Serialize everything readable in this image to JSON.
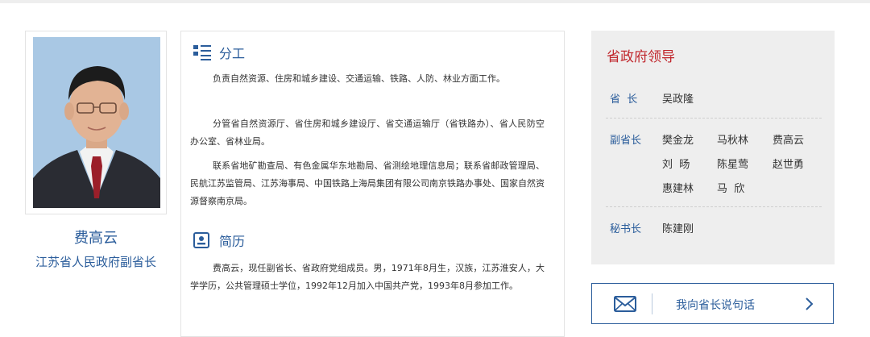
{
  "profile": {
    "name": "费高云",
    "title": "江苏省人民政府副省长"
  },
  "duties": {
    "heading": "分工",
    "paragraphs": [
      "负责自然资源、住房和城乡建设、交通运输、铁路、人防、林业方面工作。",
      "分管省自然资源厅、省住房和城乡建设厅、省交通运输厅（省铁路办）、省人民防空办公室、省林业局。",
      "联系省地矿勘查局、有色金属华东地勘局、省测绘地理信息局；联系省邮政管理局、民航江苏监管局、江苏海事局、中国铁路上海局集团有限公司南京铁路办事处、国家自然资源督察南京局。"
    ]
  },
  "resume": {
    "heading": "简历",
    "paragraph": "费高云，现任副省长、省政府党组成员。男，1971年8月生，汉族，江苏淮安人，大学学历，公共管理硕士学位，1992年12月加入中国共产党，1993年8月参加工作。"
  },
  "leaders": {
    "title": "省政府领导",
    "governor_label": "省  长",
    "governor": "吴政隆",
    "vice_label": "副省长",
    "vice": [
      "樊金龙",
      "马秋林",
      "费高云",
      "刘  旸",
      "陈星莺",
      "赵世勇",
      "惠建林",
      "马  欣"
    ],
    "secretary_label": "秘书长",
    "secretary": "陈建刚"
  },
  "message_button": {
    "label": "我向省长说句话"
  },
  "colors": {
    "accent_blue": "#2b5d9b",
    "title_red": "#c0262c",
    "panel_gray": "#eeeeee"
  },
  "icons": {
    "duties": "list-icon",
    "resume": "profile-card-icon",
    "message": "envelope-icon",
    "arrow": "chevron-right-icon"
  }
}
